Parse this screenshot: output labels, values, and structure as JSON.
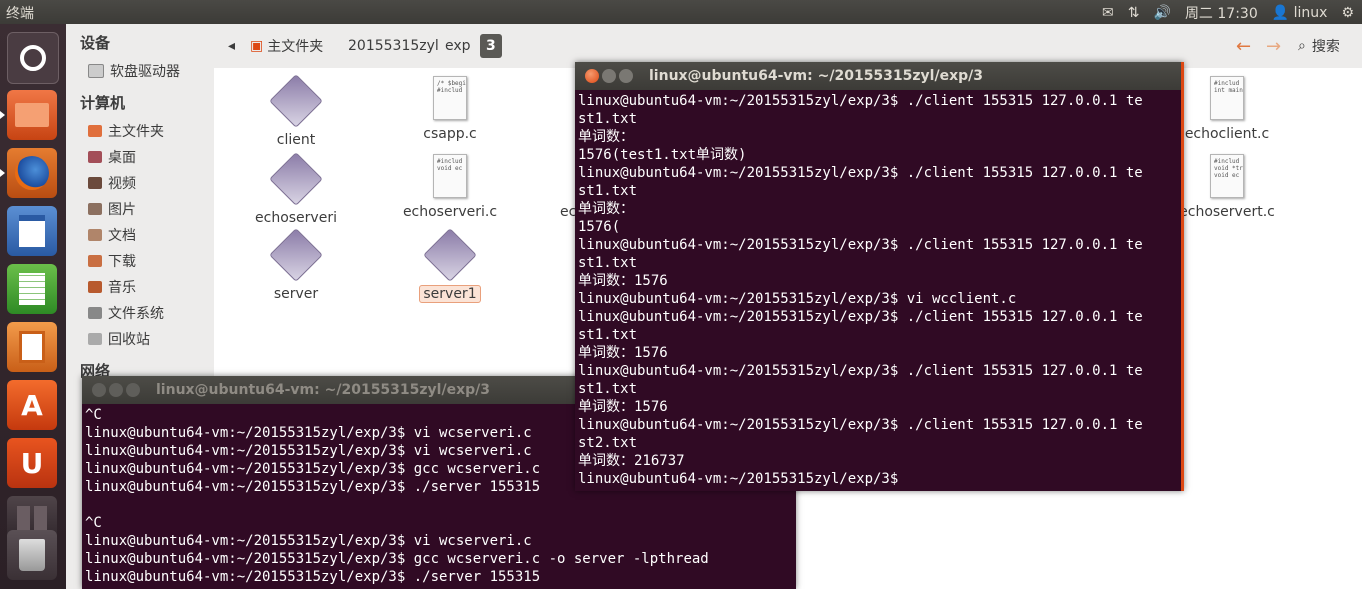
{
  "topbar": {
    "title": "终端",
    "clock": "周二 17:30",
    "user": "linux"
  },
  "launcher": {
    "icons": [
      "ubuntu-logo-icon",
      "files-icon",
      "firefox-icon",
      "writer-icon",
      "calc-icon",
      "impress-icon",
      "software-center-icon",
      "ubuntu-one-icon",
      "workspaces-icon",
      "trash-icon"
    ]
  },
  "sidebar": {
    "devices_header": "设备",
    "devices": [
      "软盘驱动器"
    ],
    "computer_header": "计算机",
    "computer": [
      "主文件夹",
      "桌面",
      "视频",
      "图片",
      "文档",
      "下载",
      "音乐",
      "文件系统",
      "回收站"
    ],
    "network_header": "网络"
  },
  "file_manager": {
    "breadcrumbs": [
      "主文件夹",
      "20155315zyl",
      "exp",
      "3"
    ],
    "search_label": "搜索",
    "files": [
      {
        "name": "client",
        "type": "exe"
      },
      {
        "name": "csapp.c",
        "type": "doc",
        "preview": "/* $begi\n#includ"
      },
      {
        "name": "echoclient.c",
        "type": "doc",
        "preview": "#includ\nint main"
      },
      {
        "name": "echoserveri",
        "type": "exe"
      },
      {
        "name": "echoserveri.c",
        "type": "doc",
        "preview": "#includ\nvoid ec"
      },
      {
        "name": "ec",
        "type": "partial"
      },
      {
        "name": "echoservert.c",
        "type": "doc",
        "preview": "#includ\nvoid *tr\nvoid ec"
      },
      {
        "name": "server",
        "type": "exe"
      },
      {
        "name": "server1",
        "type": "exe"
      }
    ]
  },
  "terminal_front": {
    "title": "linux@ubuntu64-vm: ~/20155315zyl/exp/3",
    "lines": [
      "linux@ubuntu64-vm:~/20155315zyl/exp/3$ ./client 155315 127.0.0.1 te",
      "st1.txt",
      "单词数：",
      "1576(test1.txt单词数)",
      "linux@ubuntu64-vm:~/20155315zyl/exp/3$ ./client 155315 127.0.0.1 te",
      "st1.txt",
      "单词数：",
      "1576(",
      "linux@ubuntu64-vm:~/20155315zyl/exp/3$ ./client 155315 127.0.0.1 te",
      "st1.txt",
      "单词数：1576",
      "linux@ubuntu64-vm:~/20155315zyl/exp/3$ vi wcclient.c",
      "linux@ubuntu64-vm:~/20155315zyl/exp/3$ ./client 155315 127.0.0.1 te",
      "st1.txt",
      "单词数：1576",
      "linux@ubuntu64-vm:~/20155315zyl/exp/3$ ./client 155315 127.0.0.1 te",
      "st1.txt",
      "单词数：1576",
      "linux@ubuntu64-vm:~/20155315zyl/exp/3$ ./client 155315 127.0.0.1 te",
      "st2.txt",
      "单词数：216737",
      "linux@ubuntu64-vm:~/20155315zyl/exp/3$"
    ]
  },
  "terminal_back": {
    "title": "linux@ubuntu64-vm: ~/20155315zyl/exp/3",
    "lines": [
      "^C",
      "linux@ubuntu64-vm:~/20155315zyl/exp/3$ vi wcserveri.c",
      "linux@ubuntu64-vm:~/20155315zyl/exp/3$ vi wcserveri.c",
      "linux@ubuntu64-vm:~/20155315zyl/exp/3$ gcc wcserveri.c",
      "linux@ubuntu64-vm:~/20155315zyl/exp/3$ ./server 155315",
      "",
      "^C",
      "linux@ubuntu64-vm:~/20155315zyl/exp/3$ vi wcserveri.c",
      "linux@ubuntu64-vm:~/20155315zyl/exp/3$ gcc wcserveri.c -o server -lpthread",
      "linux@ubuntu64-vm:~/20155315zyl/exp/3$ ./server 155315"
    ]
  },
  "colors": {
    "terminal_bg": "#300a24",
    "ubuntu_orange": "#dd4814"
  }
}
